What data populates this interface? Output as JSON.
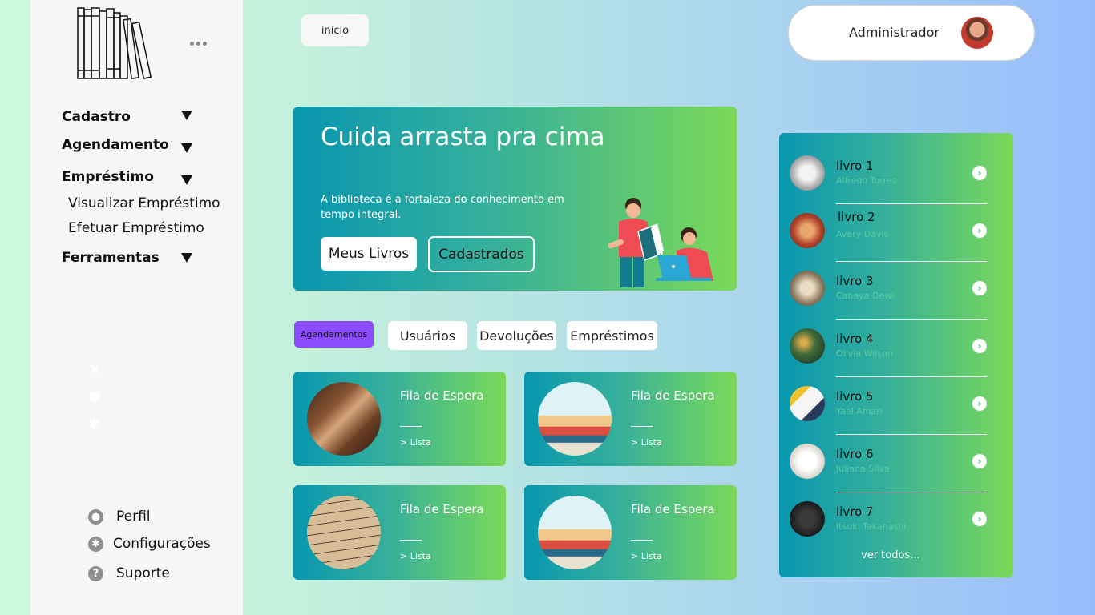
{
  "sidebar": {
    "nav": [
      {
        "label": "Cadastro"
      },
      {
        "label": "Agendamento"
      },
      {
        "label": "Empréstimo",
        "subitems": [
          "Visualizar Empréstimo",
          "Efetuar Empréstimo"
        ]
      },
      {
        "label": "Ferramentas"
      }
    ],
    "bottom": [
      {
        "label": "Perfil",
        "icon": "user-icon"
      },
      {
        "label": "Configurações",
        "icon": "gear-icon"
      },
      {
        "label": "Suporte",
        "icon": "help-icon"
      }
    ]
  },
  "header": {
    "home_button": "inicio",
    "user_name": "Administrador"
  },
  "hero": {
    "title": "Cuida arrasta pra cima",
    "text": "A biblioteca é a fortaleza do conhecimento em tempo integral.",
    "button_primary": "Meus Livros",
    "button_secondary": "Cadastrados"
  },
  "tabs": [
    "Agendamentos",
    "Usuários",
    "Devoluções",
    "Empréstimos"
  ],
  "cards": [
    {
      "title": "Fila de Espera",
      "link": "> Lista"
    },
    {
      "title": "Fila de Espera",
      "link": "> Lista"
    },
    {
      "title": "Fila de Espera",
      "link": "> Lista"
    },
    {
      "title": "Fila de Espera",
      "link": "> Lista"
    }
  ],
  "books": [
    {
      "title": "livro 1",
      "author": "Alfredo Torres"
    },
    {
      "title": "livro 2",
      "author": "Avery Davis"
    },
    {
      "title": "livro 3",
      "author": "Cahaya Dewi"
    },
    {
      "title": "livro 4",
      "author": "Olivia Wilson"
    },
    {
      "title": "livro 5",
      "author": "Yael Amari"
    },
    {
      "title": "livro 6",
      "author": "Juliana Silva"
    },
    {
      "title": "livro 7",
      "author": "Itsuki Takahashi"
    }
  ],
  "books_see_all": "ver todos...",
  "colors": {
    "gradient_start": "#0897b0",
    "gradient_end": "#7bd957",
    "active_tab": "#8b4bff",
    "sidebar_bg": "#f6f6f6"
  }
}
